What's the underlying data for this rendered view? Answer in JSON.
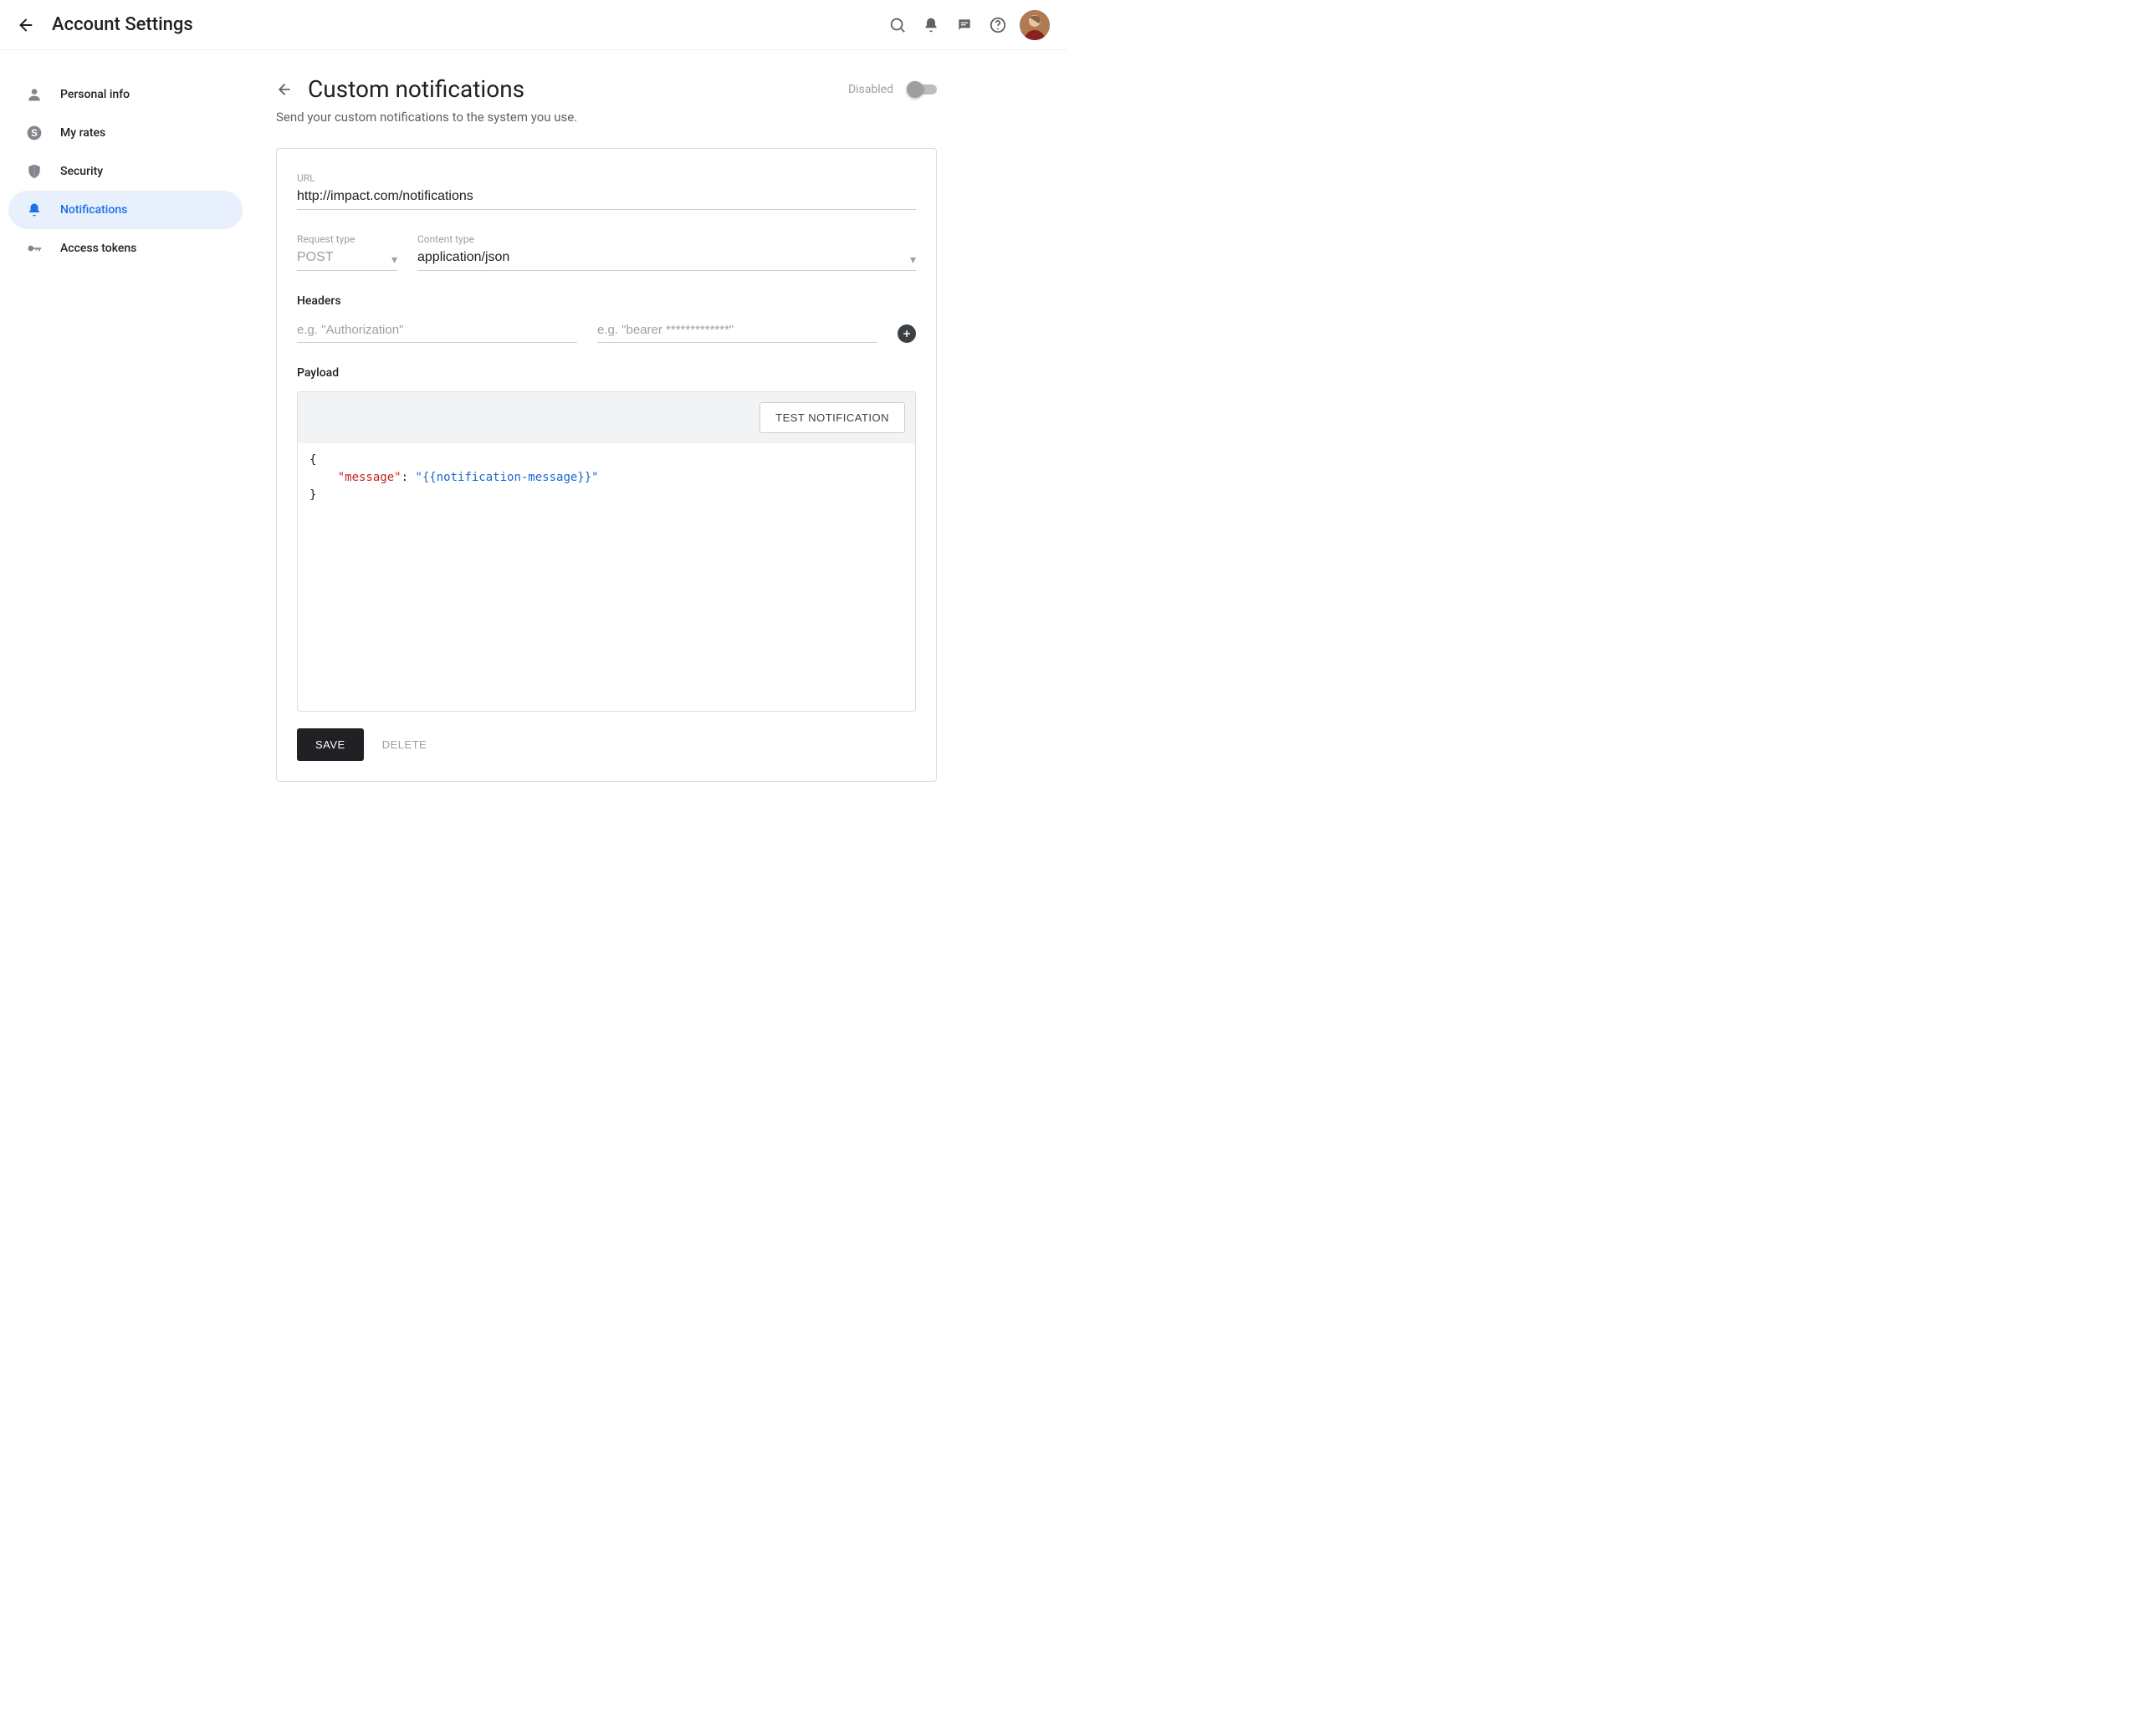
{
  "appbar": {
    "title": "Account Settings"
  },
  "sidebar": {
    "items": [
      {
        "label": "Personal info"
      },
      {
        "label": "My rates"
      },
      {
        "label": "Security"
      },
      {
        "label": "Notifications"
      },
      {
        "label": "Access tokens"
      }
    ],
    "active_index": 3
  },
  "page": {
    "title": "Custom notifications",
    "subtitle": "Send your custom notifications to the system you use.",
    "toggle": {
      "label": "Disabled",
      "on": false
    }
  },
  "form": {
    "url": {
      "label": "URL",
      "value": "http://impact.com/notifications"
    },
    "request_type": {
      "label": "Request type",
      "value": "POST"
    },
    "content_type": {
      "label": "Content type",
      "value": "application/json"
    },
    "headers": {
      "label": "Headers",
      "name_placeholder": "e.g. \"Authorization\"",
      "value_placeholder": "e.g. \"bearer *************\""
    },
    "payload": {
      "label": "Payload",
      "test_button": "TEST NOTIFICATION",
      "code": {
        "key": "\"message\"",
        "value": "\"{{notification-message}}\""
      }
    },
    "save": "SAVE",
    "delete": "DELETE"
  }
}
